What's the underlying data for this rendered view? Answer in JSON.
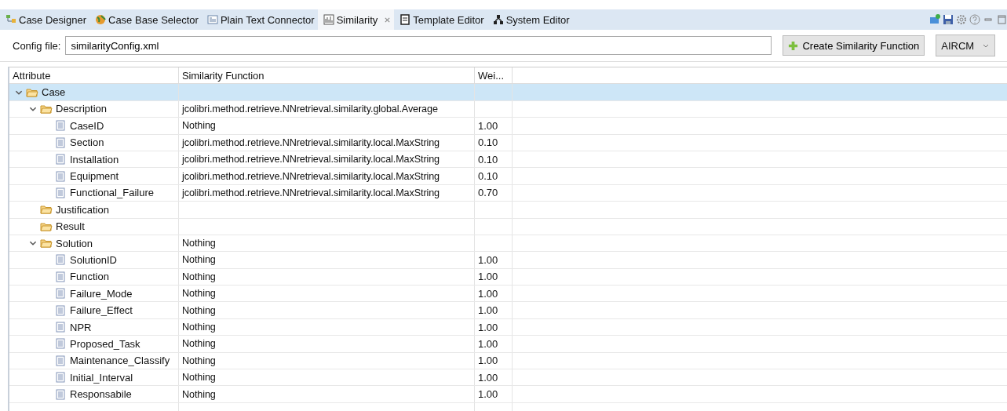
{
  "tabs": [
    {
      "label": "Case Designer",
      "selected": false
    },
    {
      "label": "Case Base Selector",
      "selected": false
    },
    {
      "label": "Plain Text Connector",
      "selected": false
    },
    {
      "label": "Similarity",
      "selected": true
    },
    {
      "label": "Template Editor",
      "selected": false
    },
    {
      "label": "System Editor",
      "selected": false
    }
  ],
  "config": {
    "label": "Config file:",
    "value": "similarityConfig.xml"
  },
  "create_button": "Create Similarity Function",
  "dropdown": {
    "value": "AIRCM"
  },
  "table": {
    "columns": [
      "Attribute",
      "Similarity Function",
      "Wei..."
    ],
    "rows": [
      {
        "kind": "folder",
        "name": "Case",
        "expanded": true,
        "selected": true,
        "children": [
          {
            "kind": "folder",
            "name": "Description",
            "expanded": true,
            "selected": false,
            "function": "jcolibri.method.retrieve.NNretrieval.similarity.global.Average",
            "children": [
              {
                "kind": "file",
                "name": "CaseID",
                "selected": false,
                "function": "Nothing",
                "weight": "1.00"
              },
              {
                "kind": "file",
                "name": "Section",
                "selected": false,
                "function": "jcolibri.method.retrieve.NNretrieval.similarity.local.MaxString",
                "weight": "0.10"
              },
              {
                "kind": "file",
                "name": "Installation",
                "selected": false,
                "function": "jcolibri.method.retrieve.NNretrieval.similarity.local.MaxString",
                "weight": "0.10"
              },
              {
                "kind": "file",
                "name": "Equipment",
                "selected": false,
                "function": "jcolibri.method.retrieve.NNretrieval.similarity.local.MaxString",
                "weight": "0.10"
              },
              {
                "kind": "file",
                "name": "Functional_Failure",
                "selected": false,
                "function": "jcolibri.method.retrieve.NNretrieval.similarity.local.MaxString",
                "weight": "0.70"
              }
            ]
          },
          {
            "kind": "folder",
            "name": "Justification",
            "expanded": false,
            "selected": false
          },
          {
            "kind": "folder",
            "name": "Result",
            "expanded": false,
            "selected": false
          },
          {
            "kind": "folder",
            "name": "Solution",
            "expanded": true,
            "selected": false,
            "function": "Nothing",
            "children": [
              {
                "kind": "file",
                "name": "SolutionID",
                "selected": false,
                "function": "Nothing",
                "weight": "1.00"
              },
              {
                "kind": "file",
                "name": "Function",
                "selected": false,
                "function": "Nothing",
                "weight": "1.00"
              },
              {
                "kind": "file",
                "name": "Failure_Mode",
                "selected": false,
                "function": "Nothing",
                "weight": "1.00"
              },
              {
                "kind": "file",
                "name": "Failure_Effect",
                "selected": false,
                "function": "Nothing",
                "weight": "1.00"
              },
              {
                "kind": "file",
                "name": "NPR",
                "selected": false,
                "function": "Nothing",
                "weight": "1.00"
              },
              {
                "kind": "file",
                "name": "Proposed_Task",
                "selected": false,
                "function": "Nothing",
                "weight": "1.00"
              },
              {
                "kind": "file",
                "name": "Maintenance_Classify",
                "selected": false,
                "function": "Nothing",
                "weight": "1.00"
              },
              {
                "kind": "file",
                "name": "Initial_Interval",
                "selected": false,
                "function": "Nothing",
                "weight": "1.00"
              },
              {
                "kind": "file",
                "name": "Responsabile",
                "selected": false,
                "function": "Nothing",
                "weight": "1.00"
              }
            ]
          }
        ]
      }
    ]
  }
}
